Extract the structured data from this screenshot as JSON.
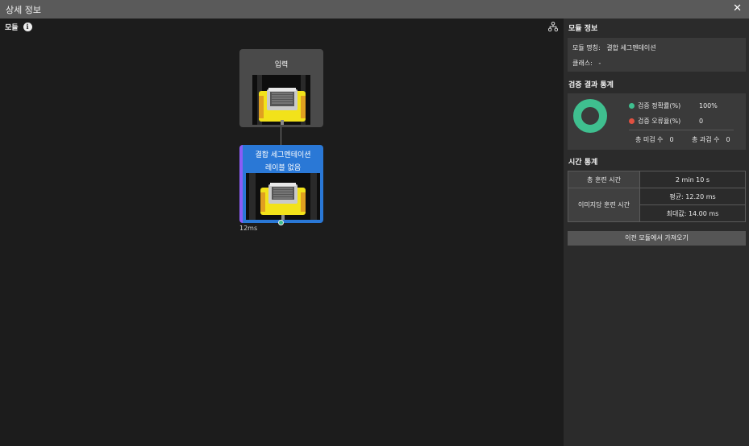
{
  "window": {
    "title": "상세 정보",
    "close_glyph": "✕"
  },
  "left_panel": {
    "header_label": "모듈",
    "info_icon_glyph": "i",
    "nodes": {
      "input": {
        "title": "입력"
      },
      "segmentation": {
        "title": "결합 세그멘테이션",
        "subtitle": "레이블 없음",
        "time": "12ms"
      }
    }
  },
  "right_panel": {
    "module_info": {
      "title": "모듈 정보",
      "name_label": "모듈 명칭:",
      "name_value": "결합 세그멘테이션",
      "class_label": "클래스:",
      "class_value": "-"
    },
    "validation": {
      "title": "검증 결과 통계",
      "accuracy_label": "검증 정확률(%)",
      "accuracy_value": "100%",
      "error_label": "검증 오류율(%)",
      "error_value": "0",
      "undetected_label": "총 미검 수",
      "undetected_value": "0",
      "overdetected_label": "총 과검 수",
      "overdetected_value": "0",
      "colors": {
        "accuracy": "#3fbf8f",
        "error": "#e05040"
      }
    },
    "time_stats": {
      "title": "시간 통계",
      "total_label": "총 훈련 시간",
      "total_value": "2 min 10 s",
      "per_image_label": "이미지당 훈련 시간",
      "avg_value": "평균: 12.20 ms",
      "max_value": "최대값: 14.00 ms"
    },
    "import_button": "이전 모듈에서 가져오기"
  }
}
